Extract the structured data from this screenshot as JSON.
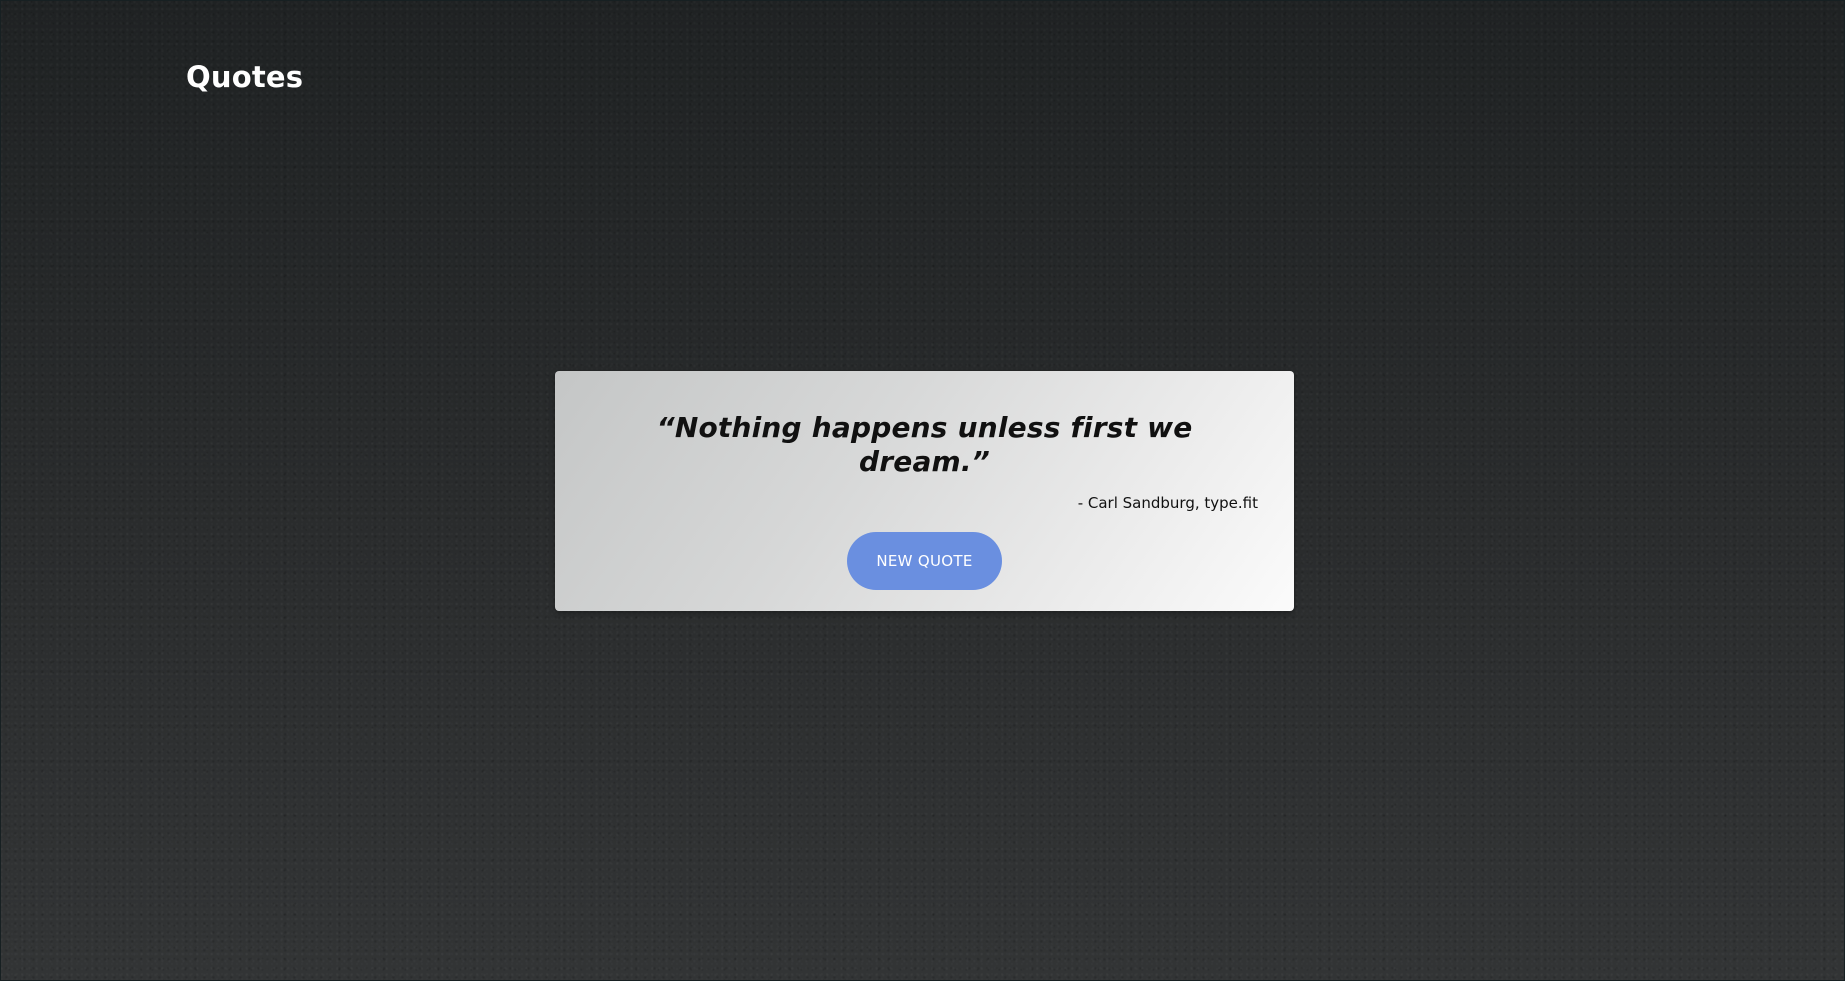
{
  "app": {
    "title": "Quotes"
  },
  "quote": {
    "text": "“Nothing happens unless first we dream.”",
    "author_line": "- Carl Sandburg, type.fit"
  },
  "actions": {
    "new_quote_label": "NEW QUOTE"
  },
  "colors": {
    "background": "#262829",
    "card_start": "#c4c6c6",
    "card_end": "#fbfbfb",
    "button": "#6a8fe0",
    "title_text": "#ffffff",
    "quote_text": "#111111"
  }
}
